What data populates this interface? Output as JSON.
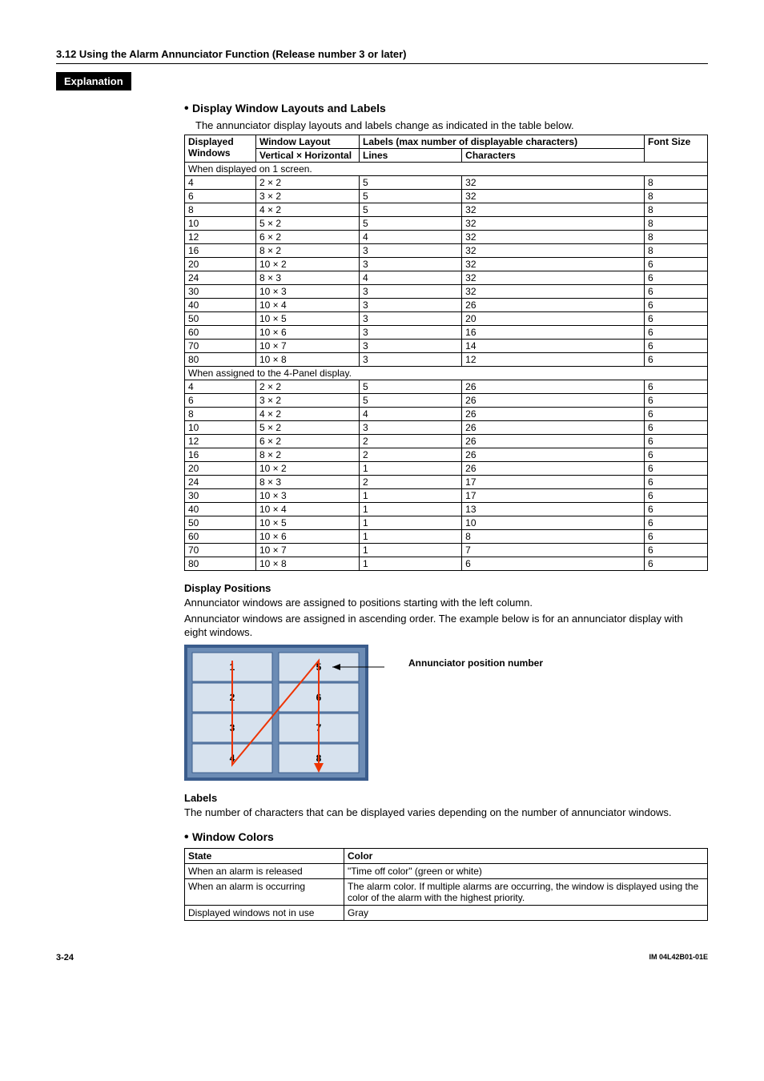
{
  "header": "3.12  Using the Alarm Annunciator Function (Release number 3 or later)",
  "explanation_label": "Explanation",
  "section_layouts_heading": "Display Window Layouts and Labels",
  "section_layouts_intro": "The annunciator display layouts and labels change as indicated in the table below.",
  "table1": {
    "h_displayed": "Displayed Windows",
    "h_layout": "Window Layout",
    "h_layout_sub": "Vertical × Horizontal",
    "h_labels": "Labels (max number of displayable characters)",
    "h_lines": "Lines",
    "h_chars": "Characters",
    "h_font": "Font Size",
    "group1_label": "When displayed on 1 screen.",
    "group1": [
      [
        "4",
        "2 × 2",
        "5",
        "32",
        "8"
      ],
      [
        "6",
        "3 × 2",
        "5",
        "32",
        "8"
      ],
      [
        "8",
        "4 × 2",
        "5",
        "32",
        "8"
      ],
      [
        "10",
        "5 × 2",
        "5",
        "32",
        "8"
      ],
      [
        "12",
        "6 × 2",
        "4",
        "32",
        "8"
      ],
      [
        "16",
        "8 × 2",
        "3",
        "32",
        "8"
      ],
      [
        "20",
        "10 × 2",
        "3",
        "32",
        "6"
      ],
      [
        "24",
        "8 × 3",
        "4",
        "32",
        "6"
      ],
      [
        "30",
        "10 × 3",
        "3",
        "32",
        "6"
      ],
      [
        "40",
        "10 × 4",
        "3",
        "26",
        "6"
      ],
      [
        "50",
        "10 × 5",
        "3",
        "20",
        "6"
      ],
      [
        "60",
        "10 × 6",
        "3",
        "16",
        "6"
      ],
      [
        "70",
        "10 × 7",
        "3",
        "14",
        "6"
      ],
      [
        "80",
        "10 × 8",
        "3",
        "12",
        "6"
      ]
    ],
    "group2_label": "When assigned to the 4-Panel display.",
    "group2": [
      [
        "4",
        "2 × 2",
        "5",
        "26",
        "6"
      ],
      [
        "6",
        "3 × 2",
        "5",
        "26",
        "6"
      ],
      [
        "8",
        "4 × 2",
        "4",
        "26",
        "6"
      ],
      [
        "10",
        "5 × 2",
        "3",
        "26",
        "6"
      ],
      [
        "12",
        "6 × 2",
        "2",
        "26",
        "6"
      ],
      [
        "16",
        "8 × 2",
        "2",
        "26",
        "6"
      ],
      [
        "20",
        "10 × 2",
        "1",
        "26",
        "6"
      ],
      [
        "24",
        "8 × 3",
        "2",
        "17",
        "6"
      ],
      [
        "30",
        "10 × 3",
        "1",
        "17",
        "6"
      ],
      [
        "40",
        "10 × 4",
        "1",
        "13",
        "6"
      ],
      [
        "50",
        "10 × 5",
        "1",
        "10",
        "6"
      ],
      [
        "60",
        "10 × 6",
        "1",
        "8",
        "6"
      ],
      [
        "70",
        "10 × 7",
        "1",
        "7",
        "6"
      ],
      [
        "80",
        "10 × 8",
        "1",
        "6",
        "6"
      ]
    ]
  },
  "positions_heading": "Display Positions",
  "positions_text1": "Annunciator windows are assigned to positions starting with the left column.",
  "positions_text2": "Annunciator windows are assigned in ascending order. The example below is for an annunciator display with eight windows.",
  "diagram_cells": [
    "1",
    "2",
    "3",
    "4",
    "5",
    "6",
    "7",
    "8"
  ],
  "diagram_caption": "Annunciator position number",
  "labels_heading": "Labels",
  "labels_text": "The number of characters that can be displayed varies depending on the number of annunciator windows.",
  "colors_heading": "Window Colors",
  "colors_table": {
    "h_state": "State",
    "h_color": "Color",
    "rows": [
      [
        "When an alarm is released",
        "\"Time off color\" (green or white)"
      ],
      [
        "When an alarm is occurring",
        "The alarm color. If multiple alarms are occurring, the window is displayed using the color of the alarm with the highest priority."
      ],
      [
        "Displayed windows not in use",
        "Gray"
      ]
    ]
  },
  "footer_page": "3-24",
  "footer_doc": "IM 04L42B01-01E"
}
